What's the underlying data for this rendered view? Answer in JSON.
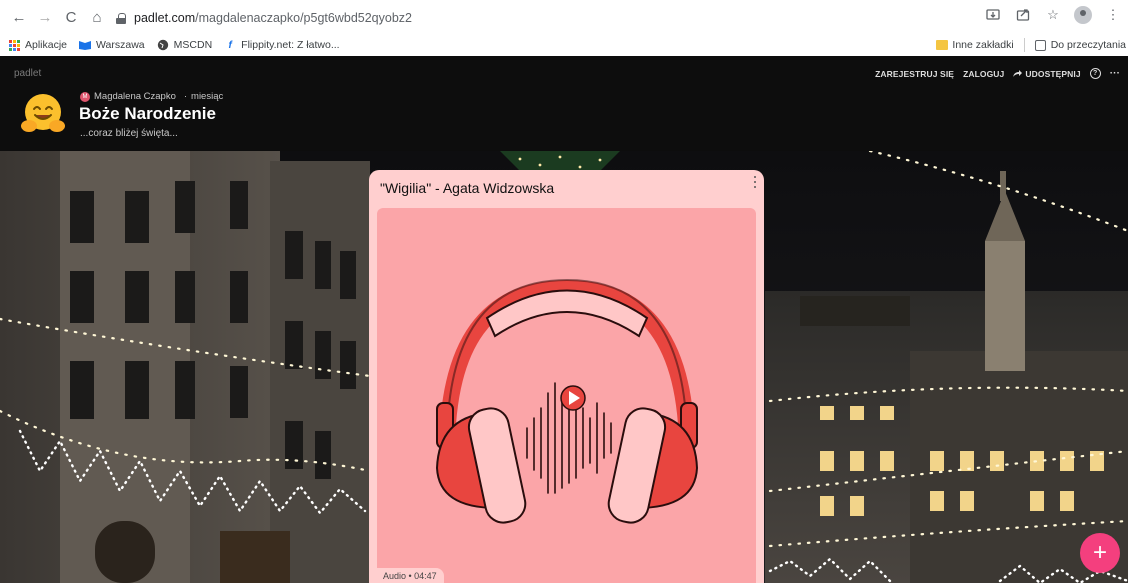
{
  "browser": {
    "nav": {
      "back": "←",
      "forward": "→",
      "reload": "C",
      "home": "⌂"
    },
    "url_host": "padlet.com",
    "url_path": "/magdalenaczapko/p5gt6wbd52qyobz2",
    "bookmarks": [
      "Aplikacje",
      "Warszawa",
      "MSCDN",
      "Flippity.net: Z łatwo..."
    ],
    "bookmarks_right": [
      "Inne zakładki",
      "Do przeczytania"
    ]
  },
  "padlet": {
    "logo": "padlet",
    "actions": [
      "ZAREJESTRUJ SIĘ",
      "ZALOGUJ",
      "UDOSTĘPNIJ"
    ],
    "more": "···",
    "author_initial": "M",
    "author": "Magdalena Czapko",
    "time": "miesiąc",
    "title": "Boże Narodzenie",
    "subtitle": "...coraz bliżej święta..."
  },
  "post": {
    "title": "\"Wigilia\" - Agata Widzowska",
    "audio_meta": "Audio • 04:47"
  },
  "fab_label": "+",
  "colors": {
    "card": "#ffcfcf",
    "art_bg": "#fba5a8",
    "headphone_red": "#e8453f",
    "fab": "#f43f7e"
  }
}
